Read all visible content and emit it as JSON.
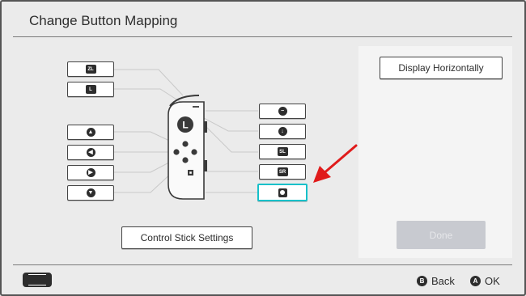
{
  "header": {
    "title": "Change Button Mapping"
  },
  "left_buttons": [
    {
      "name": "zl-button",
      "glyph": "ZL",
      "shape": "square"
    },
    {
      "name": "l-button",
      "glyph": "L",
      "shape": "square"
    },
    {
      "name": "dpad-up-button",
      "glyph": "▲",
      "shape": "circle"
    },
    {
      "name": "dpad-left-button",
      "glyph": "◀",
      "shape": "circle"
    },
    {
      "name": "dpad-right-button",
      "glyph": "▶",
      "shape": "circle"
    },
    {
      "name": "dpad-down-button",
      "glyph": "▼",
      "shape": "circle"
    }
  ],
  "right_buttons": [
    {
      "name": "minus-button",
      "glyph": "−",
      "shape": "circle"
    },
    {
      "name": "stick-press-button",
      "glyph": "↓",
      "shape": "circle"
    },
    {
      "name": "sl-button",
      "glyph": "SL",
      "shape": "square"
    },
    {
      "name": "sr-button",
      "glyph": "SR",
      "shape": "square"
    },
    {
      "name": "capture-button",
      "glyph": "",
      "shape": "capture",
      "selected": true
    }
  ],
  "joycon": {
    "stick_label": "L"
  },
  "buttons": {
    "display_horizontally": "Display Horizontally",
    "control_stick_settings": "Control Stick Settings",
    "done": "Done"
  },
  "footer": {
    "back_glyph": "B",
    "back_label": "Back",
    "ok_glyph": "A",
    "ok_label": "OK"
  },
  "colors": {
    "selection": "#16c0c9",
    "arrow": "#e01b1b",
    "done_disabled": "#c8cad0"
  }
}
